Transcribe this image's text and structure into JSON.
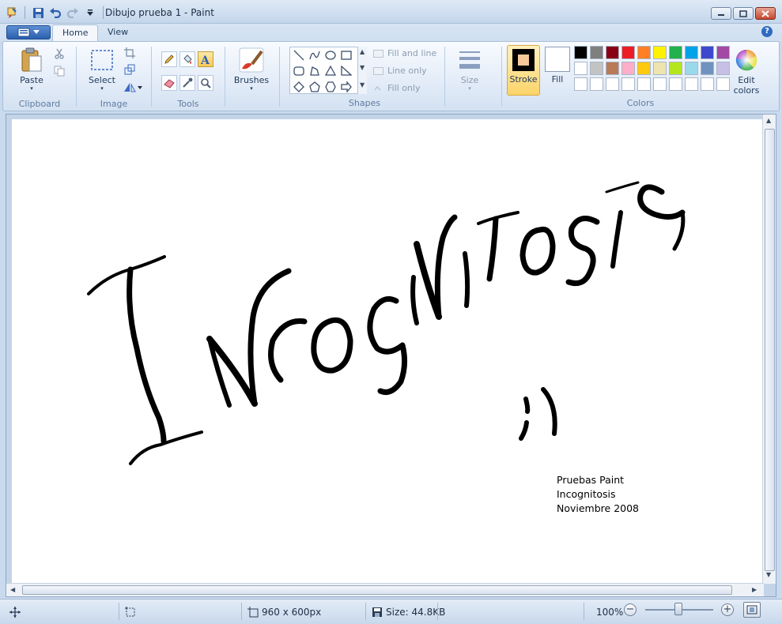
{
  "window": {
    "title": "Dibujo prueba 1 - Paint"
  },
  "tabs": [
    {
      "label": "Home",
      "active": true
    },
    {
      "label": "View",
      "active": false
    }
  ],
  "ribbon": {
    "clipboard": {
      "group_label": "Clipboard",
      "paste_label": "Paste"
    },
    "image": {
      "group_label": "Image",
      "select_label": "Select"
    },
    "tools": {
      "group_label": "Tools"
    },
    "brushes": {
      "label": "Brushes"
    },
    "shapes": {
      "group_label": "Shapes",
      "fill_and_line": "Fill and line",
      "line_only": "Line only",
      "fill_only": "Fill only"
    },
    "size": {
      "label": "Size"
    },
    "colors": {
      "group_label": "Colors",
      "stroke_label": "Stroke",
      "fill_label": "Fill",
      "edit_colors_line1": "Edit",
      "edit_colors_line2": "colors",
      "stroke_color": "#000000",
      "stroke_inner": "#f7c99a",
      "fill_color": "#ffffff",
      "palette_row1": [
        "#000000",
        "#7f7f7f",
        "#880015",
        "#ed1c24",
        "#ff7f27",
        "#fff200",
        "#22b14c",
        "#00a2e8",
        "#3f48cc",
        "#a349a4"
      ],
      "palette_row2": [
        "#ffffff",
        "#c3c3c3",
        "#b97a57",
        "#ffaec9",
        "#ffc90e",
        "#efe4b0",
        "#b5e61d",
        "#99d9ea",
        "#7092be",
        "#c8bfe7"
      ],
      "palette_row3": [
        "#ffffff",
        "#ffffff",
        "#ffffff",
        "#ffffff",
        "#ffffff",
        "#ffffff",
        "#ffffff",
        "#ffffff",
        "#ffffff",
        "#ffffff"
      ]
    }
  },
  "canvas": {
    "drawing_text": "INCOGNITOSIS",
    "smiley": ";)",
    "note_lines": [
      "Pruebas Paint",
      "Incognitosis",
      "Noviembre 2008"
    ]
  },
  "status": {
    "dimensions": "960 x 600px",
    "file_size": "Size: 44.8KB",
    "zoom": "100%"
  }
}
